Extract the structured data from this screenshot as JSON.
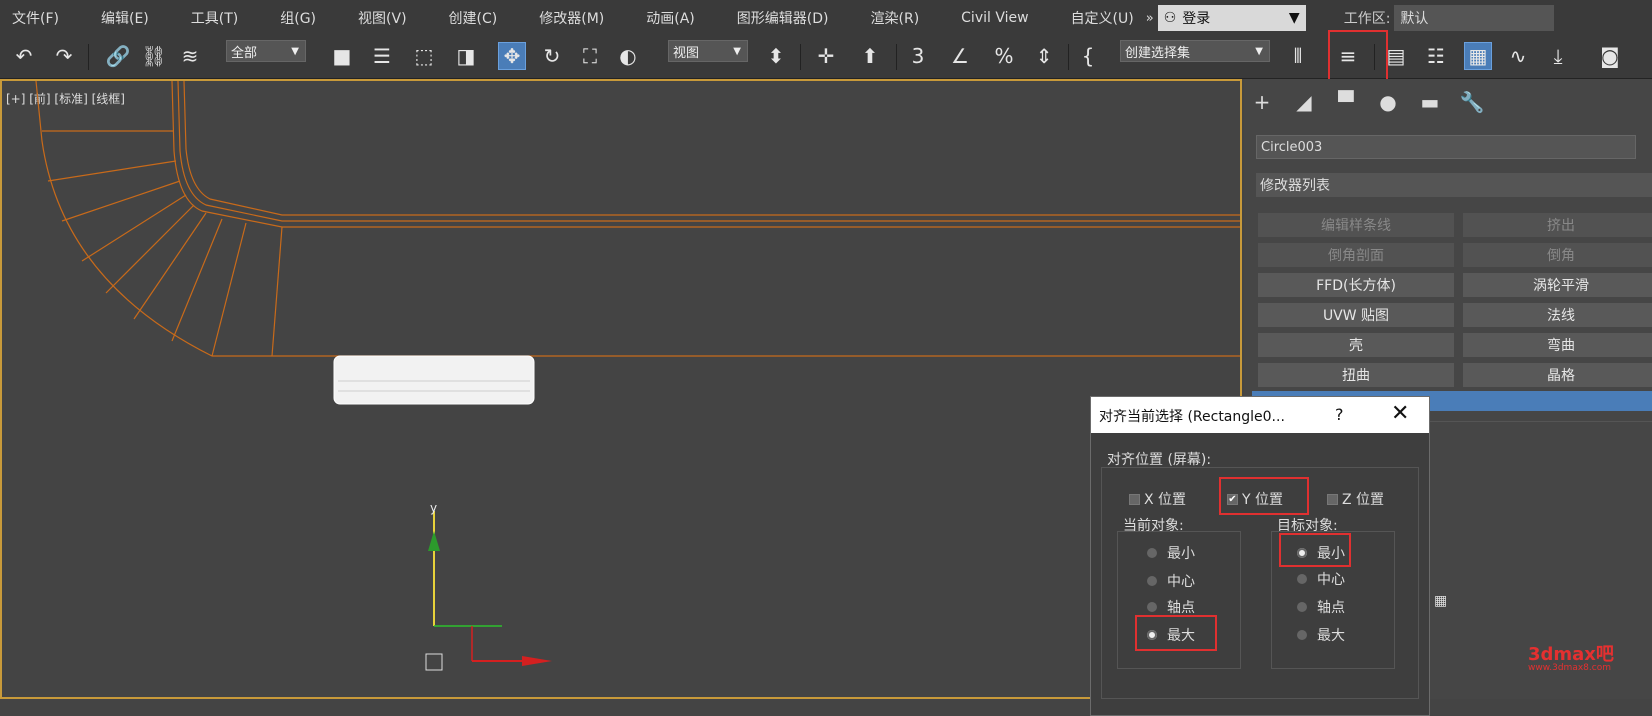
{
  "menubar": {
    "items": [
      "文件(F)",
      "编辑(E)",
      "工具(T)",
      "组(G)",
      "视图(V)",
      "创建(C)",
      "修改器(M)",
      "动画(A)",
      "图形编辑器(D)",
      "渲染(R)",
      "Civil View",
      "自定义(U)"
    ],
    "expand": "»",
    "login": "登录",
    "workspace_label": "工作区:",
    "workspace_value": "默认"
  },
  "toolbar": {
    "filter_dropdown": "全部",
    "view_dropdown": "视图",
    "selection_set": "创建选择集"
  },
  "viewport": {
    "label": "[+] [前] [标准] [线框]",
    "axis_y": "y"
  },
  "panel": {
    "object_name": "Circle003",
    "modifier_list": "修改器列表",
    "modifiers": [
      {
        "label": "编辑样条线",
        "enabled": false
      },
      {
        "label": "挤出",
        "enabled": false
      },
      {
        "label": "倒角剖面",
        "enabled": false
      },
      {
        "label": "倒角",
        "enabled": false
      },
      {
        "label": "FFD(长方体)",
        "enabled": true
      },
      {
        "label": "涡轮平滑",
        "enabled": true
      },
      {
        "label": "UVW 贴图",
        "enabled": true
      },
      {
        "label": "法线",
        "enabled": true
      },
      {
        "label": "壳",
        "enabled": true
      },
      {
        "label": "弯曲",
        "enabled": true
      },
      {
        "label": "扭曲",
        "enabled": true
      },
      {
        "label": "晶格",
        "enabled": true
      }
    ]
  },
  "dialog": {
    "title": "对齐当前选择 (Rectangle0...",
    "help": "?",
    "close": "✕",
    "group_label": "对齐位置 (屏幕):",
    "x_label": "X 位置",
    "y_label": "Y 位置",
    "z_label": "Z 位置",
    "y_checked": "✔",
    "current_label": "当前对象:",
    "target_label": "目标对象:",
    "current_options": [
      "最小",
      "中心",
      "轴点",
      "最大"
    ],
    "target_options": [
      "最小",
      "中心",
      "轴点",
      "最大"
    ],
    "current_selected": "最大",
    "target_selected": "最小"
  },
  "watermark": {
    "main": "3dmax吧",
    "sub": "www.3dmax8.com"
  },
  "colors": {
    "accent": "#4a7db8",
    "highlight": "#e03030",
    "selection_edge": "#c86a1a"
  }
}
